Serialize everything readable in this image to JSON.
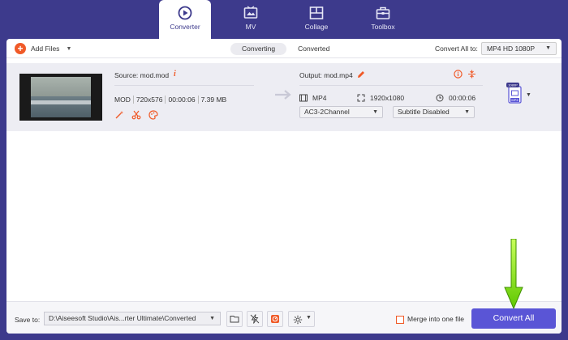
{
  "nav": {
    "tabs": [
      {
        "label": "Converter",
        "icon": "converter-icon",
        "active": true
      },
      {
        "label": "MV",
        "icon": "mv-icon",
        "active": false
      },
      {
        "label": "Collage",
        "icon": "collage-icon",
        "active": false
      },
      {
        "label": "Toolbox",
        "icon": "toolbox-icon",
        "active": false
      }
    ]
  },
  "toolbar": {
    "add_files_label": "Add Files",
    "segments": [
      "Converting",
      "Converted"
    ],
    "convert_all_label": "Convert All to:",
    "convert_all_value": "MP4 HD 1080P"
  },
  "file": {
    "source_label": "Source: mod.mod",
    "format": "MOD",
    "resolution": "720x576",
    "duration": "00:00:06",
    "size": "7.39 MB",
    "output_label": "Output: mod.mp4",
    "out_format": "MP4",
    "out_resolution": "1920x1080",
    "out_duration": "00:00:06",
    "audio_track": "AC3-2Channel",
    "subtitle": "Subtitle Disabled",
    "badge_top": "1080P",
    "badge_bottom": "MP4"
  },
  "bottom": {
    "save_to_label": "Save to:",
    "save_path": "D:\\Aiseesoft Studio\\Ais...rter Ultimate\\Converted",
    "merge_label": "Merge into one file",
    "merge_checked": false,
    "convert_button": "Convert All"
  },
  "colors": {
    "nav_bg": "#3d3a8c",
    "accent": "#f05a28",
    "primary_button": "#5a55d6",
    "highlight_arrow": "#7fe000"
  }
}
